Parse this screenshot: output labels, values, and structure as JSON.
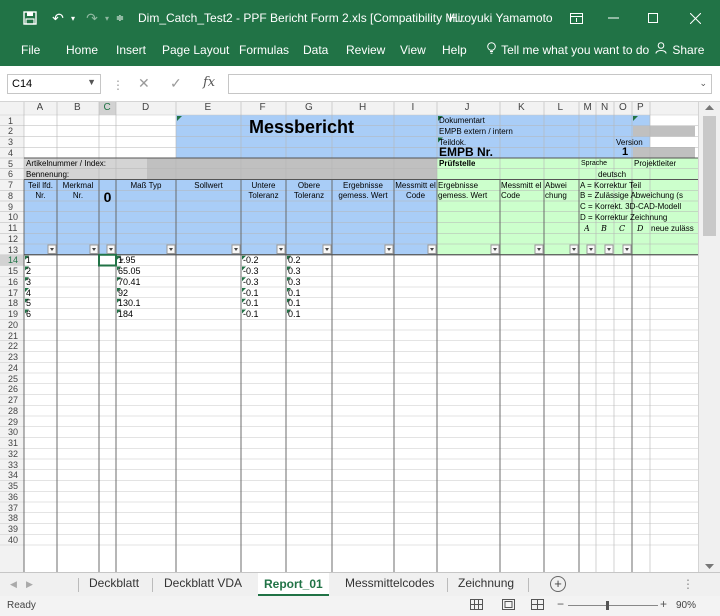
{
  "titlebar": {
    "save_icon": "save-icon",
    "undo_icon": "undo-icon",
    "redo_icon": "redo-icon",
    "title": "Dim_Catch_Test2 - PPF Bericht Form 2.xls  [Compatibility M...",
    "user": "Hiroyuki Yamamoto"
  },
  "ribbon": {
    "tabs": [
      "File",
      "Home",
      "Insert",
      "Page Layout",
      "Formulas",
      "Data",
      "Review",
      "View",
      "Help"
    ],
    "tell_me": "Tell me what you want to do",
    "share": "Share"
  },
  "formula_bar": {
    "name_box": "C14",
    "formula": ""
  },
  "grid": {
    "columns": [
      "A",
      "B",
      "C",
      "D",
      "E",
      "F",
      "G",
      "H",
      "I",
      "J",
      "K",
      "L",
      "M",
      "N",
      "O",
      "P"
    ],
    "selected_column": "C",
    "rows": [
      "1",
      "2",
      "3",
      "4",
      "5",
      "6",
      "7",
      "8",
      "9",
      "10",
      "11",
      "12",
      "13",
      "14",
      "15",
      "16",
      "17",
      "18",
      "19",
      "20",
      "21",
      "22",
      "23",
      "24",
      "25",
      "26",
      "27",
      "28",
      "29",
      "30",
      "31",
      "32",
      "33",
      "34",
      "35",
      "36",
      "37",
      "38",
      "39",
      "40"
    ],
    "header": {
      "messbericht": "Messbericht",
      "dokumentart": "Dokumentart",
      "empb_extern": "EMPB extern / intern",
      "teildok": "Teildok.",
      "version": "Version",
      "empb_nr": "EMPB Nr.",
      "version_value": "1",
      "artikelnummer": "Artikelnummer / Index:",
      "benennung": "Bennenung:",
      "pruefstelle": "Prüfstelle",
      "sprache": "Sprache",
      "sprache_value": "deutsch",
      "projektleiter": "Projektleiter"
    },
    "column_headers": {
      "teil_lfd": "Teil lfd. Nr.",
      "merkmal": "Merkmal Nr.",
      "c_symbol": "0",
      "mass_typ": "Maß Typ",
      "sollwert": "Sollwert",
      "untere": "Untere Toleranz",
      "obere": "Obere Toleranz",
      "ergebnisse": "Ergebnisse gemess. Wert",
      "messmittel": "Messmitt el Code",
      "ergebnisse2": "Ergebnisse gemess. Wert",
      "messmittel2": "Messmitt el Code",
      "abweichung": "Abwei chung",
      "legend": [
        "A = Korrektur Teil",
        "B = Zulässige Abweichung (s",
        "C = Korrekt. 3D-CAD-Modell",
        "D = Korrektur Zeichnung"
      ],
      "abcd": [
        "A",
        "B",
        "C",
        "D"
      ],
      "neue": "neue zuläss"
    },
    "data_rows": [
      {
        "a": "1",
        "d": "1.95",
        "f": "-0.2",
        "g": "0.2"
      },
      {
        "a": "2",
        "d": "65.05",
        "f": "-0.3",
        "g": "0.3"
      },
      {
        "a": "3",
        "d": "70.41",
        "f": "-0.3",
        "g": "0.3"
      },
      {
        "a": "4",
        "d": "92",
        "f": "-0.1",
        "g": "0.1"
      },
      {
        "a": "5",
        "d": "130.1",
        "f": "-0.1",
        "g": "0.1"
      },
      {
        "a": "6",
        "d": "184",
        "f": "-0.1",
        "g": "0.1"
      }
    ]
  },
  "sheets": {
    "tabs": [
      "Deckblatt",
      "Deckblatt VDA",
      "Report_01",
      "Messmittelcodes",
      "Zeichnung"
    ],
    "active": "Report_01"
  },
  "status": {
    "ready": "Ready",
    "zoom": "90%"
  },
  "colors": {
    "excel_green": "#217346",
    "header_blue": "#a9cdf7",
    "light_green": "#ccffcc",
    "gray": "#c0c0c0"
  }
}
